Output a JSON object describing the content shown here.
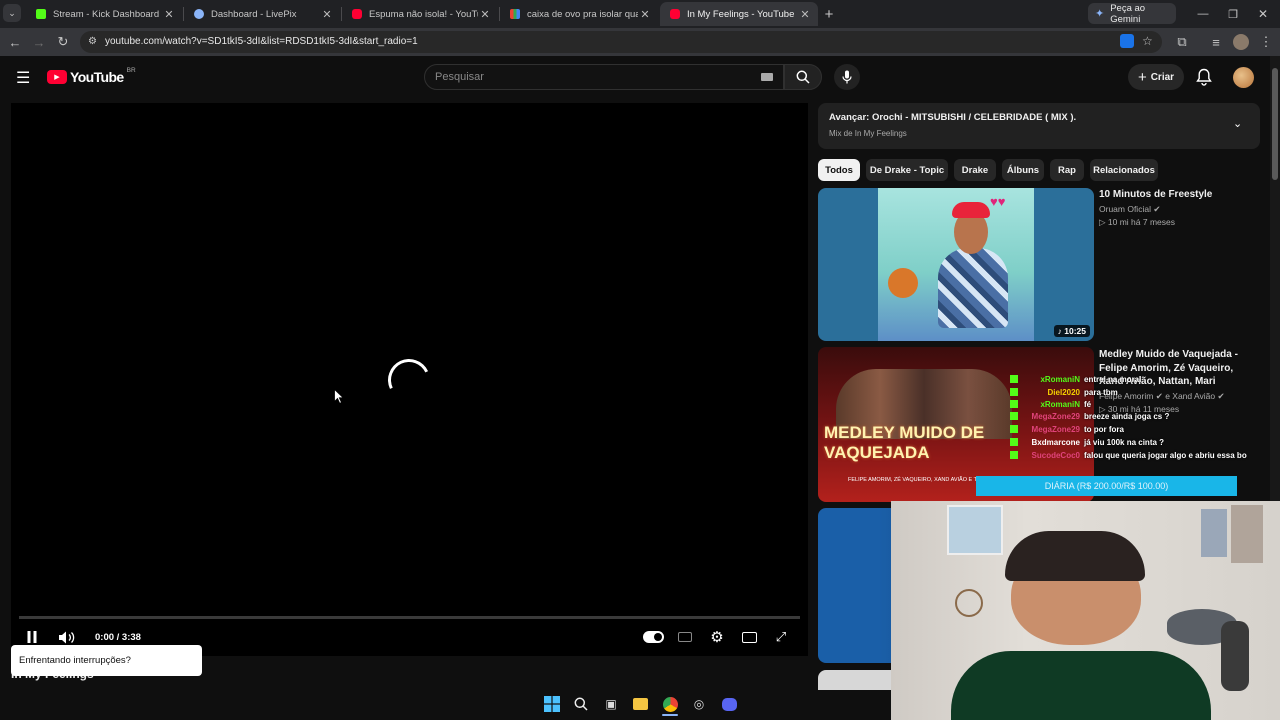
{
  "browser": {
    "tabs": [
      {
        "title": "Stream - Kick Dashboard",
        "color": "#53fc18"
      },
      {
        "title": "Dashboard - LivePix",
        "color": "#8ab4f8"
      },
      {
        "title": "Espuma não isola! - YouTube",
        "color": "#ff0033"
      },
      {
        "title": "caixa de ovo pra isolar quarto -",
        "color": "#4285f4"
      },
      {
        "title": "In My Feelings - YouTube",
        "color": "#ff0033"
      }
    ],
    "new_tab": "+",
    "gemini": "Peça ao Gemini",
    "url": "youtube.com/watch?v=SD1tkI5-3dI&list=RDSD1tkI5-3dI&start_radio=1"
  },
  "yt": {
    "logo": "YouTube",
    "region": "BR",
    "search_placeholder": "Pesquisar",
    "create": "Criar"
  },
  "player": {
    "time": "0:00 / 3:38",
    "toast": "Enfrentando interrupções?",
    "below_title": "In My Feelings"
  },
  "mix": {
    "next": "Avançar: Orochi - MITSUBISHI / CELEBRIDADE ( MIX ).",
    "subtitle": "Mix de In My Feelings"
  },
  "chips": [
    "Todos",
    "De Drake - Topic",
    "Drake",
    "Álbuns",
    "Rap",
    "Relacionados"
  ],
  "videos": [
    {
      "title": "10 Minutos de Freestyle",
      "channel": "Oruam Oficial",
      "meta": "10 mi  há 7 meses",
      "duration": "10:25"
    },
    {
      "title": "Medley Muido de Vaquejada - Felipe Amorim, Zé Vaqueiro, Xand Avião, Nattan, Mari Fernandez, Tarcísio do Acordeon, Mel e Mc Lekão",
      "channel": "Felipe Amorim",
      "channel2": "e Xand Avião",
      "meta": "30 mi  há 11 meses",
      "thumb_text": "MEDLEY MUIDO DE VAQUEJADA",
      "thumb_sub": "FELIPE AMORIM, ZÉ VAQUEIRO, XAND AVIÃO E TAL"
    }
  ],
  "chat": [
    {
      "user": "xRomaniN",
      "msg": "entrei na moral",
      "color": "#53fc18"
    },
    {
      "user": "Diel2020",
      "msg": "para tbm",
      "color": "#f5d000"
    },
    {
      "user": "xRomaniN",
      "msg": "fé",
      "color": "#53fc18"
    },
    {
      "user": "MegaZone29",
      "msg": "breeze ainda joga cs ?",
      "color": "#e0437a"
    },
    {
      "user": "MegaZone29",
      "msg": "to por fora",
      "color": "#e0437a"
    },
    {
      "user": "Bxdmarcone",
      "msg": "já viu 100k na cinta ?",
      "color": "#ffffff"
    },
    {
      "user": "SucodeCoc0",
      "msg": "falou que queria jogar algo e abriu essa bo",
      "color": "#e0437a"
    }
  ],
  "donation": "DIÁRIA (R$ 200.00/R$ 100.00)",
  "colors": {
    "accent": "#ff0033",
    "kick": "#53fc18",
    "donation": "#19b6e8"
  }
}
